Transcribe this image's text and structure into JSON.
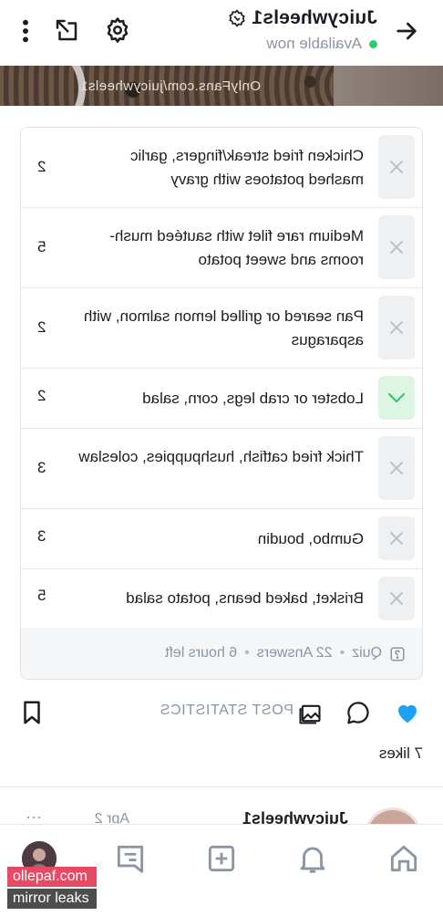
{
  "header": {
    "profile_name": "Juicywheels1",
    "status": "Available now"
  },
  "cover": {
    "watermark": "OnlyFans.com/juicywheels1"
  },
  "poll": {
    "options": [
      {
        "text": "Chicken fried streak/fingers, garlic mashed potatoes with gravy",
        "count": "2",
        "state": "wrong"
      },
      {
        "text": "Medium rare filet with sautéed mush-rooms and sweet potato",
        "count": "5",
        "state": "wrong"
      },
      {
        "text": "Pan seared or grilled lemon salmon, with asparagus",
        "count": "2",
        "state": "wrong"
      },
      {
        "text": "Lobster or crab legs, corn, salad",
        "count": "2",
        "state": "correct"
      },
      {
        "text": "Thick fried catfish, hushpuppies, coleslaw",
        "count": "3",
        "state": "wrong"
      },
      {
        "text": "Gumbo, boudin",
        "count": "3",
        "state": "wrong"
      },
      {
        "text": "Brisket, baked beans, potato salad",
        "count": "5",
        "state": "wrong"
      }
    ],
    "type": "Quiz",
    "answers": "22 Answers",
    "time_left": "6 hours left"
  },
  "actions": {
    "post_statistics": "POST STATISTICS",
    "likes": "7 likes"
  },
  "next_post": {
    "name": "Juicywheels1",
    "date": "Apr 2",
    "more": "···"
  },
  "overlay": {
    "line1": "ollepaf.com",
    "line2": "mirror leaks"
  },
  "colors": {
    "like": "#1da1f2",
    "online": "#2ecc71",
    "correct_bg": "#dff5e3",
    "correct_check": "#2ecc71"
  }
}
